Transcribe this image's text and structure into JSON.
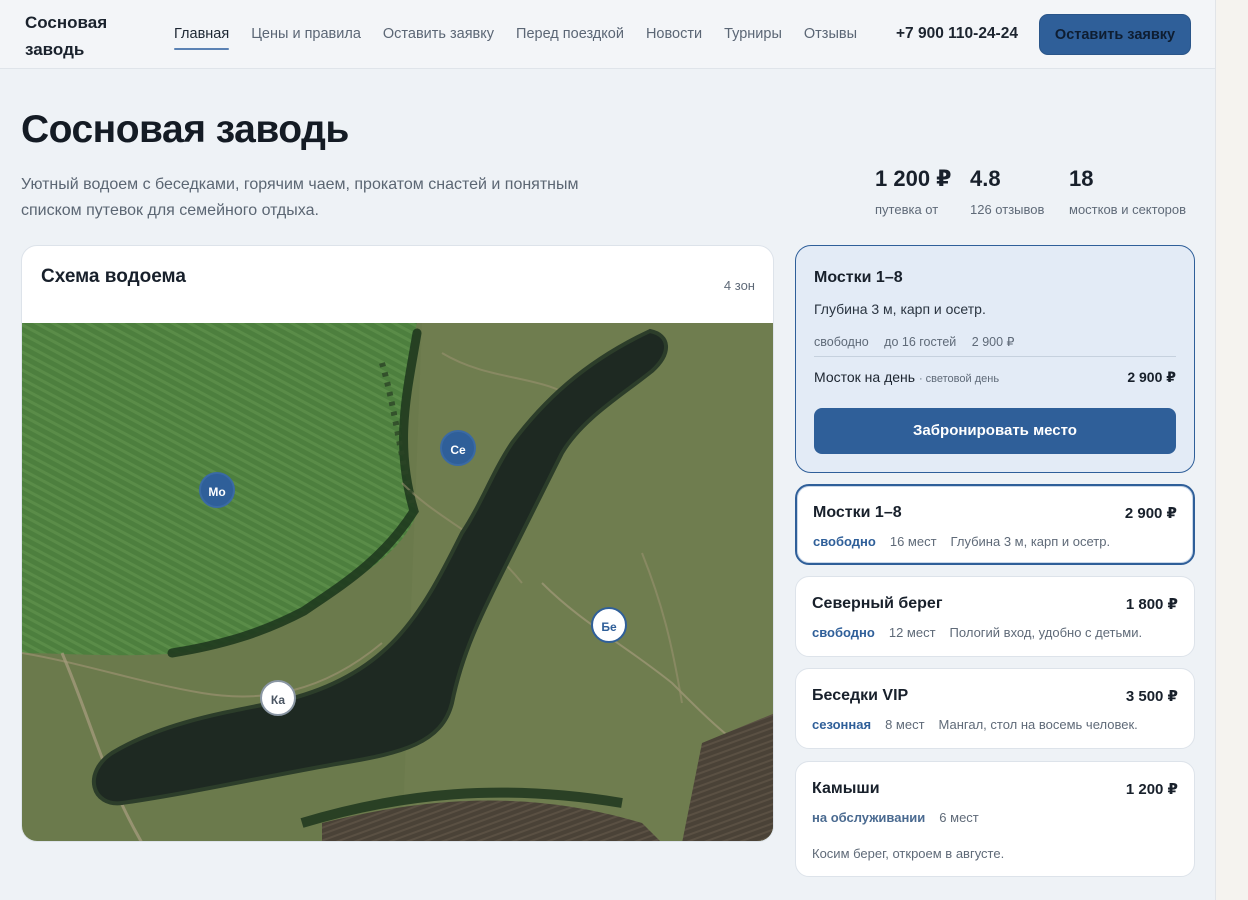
{
  "brand": {
    "line1": "Сосновая",
    "line2": "заводь"
  },
  "nav": [
    {
      "label": "Главная",
      "active": true
    },
    {
      "label": "Цены и правила"
    },
    {
      "label": "Оставить заявку"
    },
    {
      "label": "Перед поездкой"
    },
    {
      "label": "Новости"
    },
    {
      "label": "Турниры"
    },
    {
      "label": "Отзывы"
    }
  ],
  "header": {
    "phone": "+7 900 110-24-24",
    "cta": "Оставить заявку"
  },
  "hero": {
    "title": "Сосновая заводь",
    "subtitle": "Уютный водоем с беседками, горячим чаем, прокатом снастей и понятным списком путевок для семейного отдыха."
  },
  "stats": [
    {
      "value": "1 200 ₽",
      "label": "путевка от"
    },
    {
      "value": "4.8",
      "label": "126 отзывов"
    },
    {
      "value": "18",
      "label": "мостков и секторов"
    }
  ],
  "map": {
    "title": "Схема водоема",
    "zone_count": "4 зон",
    "markers": [
      {
        "label": "Мо",
        "style": "filled"
      },
      {
        "label": "Се",
        "style": "filled"
      },
      {
        "label": "Бе",
        "style": "outline"
      },
      {
        "label": "Ка",
        "style": "plain"
      }
    ]
  },
  "selected": {
    "name": "Мостки 1–8",
    "description": "Глубина 3 м, карп и осетр.",
    "meta": [
      "свободно",
      "до 16 гостей",
      "2 900 ₽"
    ],
    "rate_label": "Мосток на день",
    "rate_note": "· световой день",
    "rate_price": "2 900 ₽",
    "book_button": "Забронировать место"
  },
  "zones": [
    {
      "name": "Мостки 1–8",
      "price": "2 900 ₽",
      "status": "свободно",
      "places": "16 мест",
      "description": "Глубина 3 м, карп и осетр.",
      "active": true
    },
    {
      "name": "Северный берег",
      "price": "1 800 ₽",
      "status": "свободно",
      "places": "12 мест",
      "description": "Пологий вход, удобно с детьми."
    },
    {
      "name": "Беседки VIP",
      "price": "3 500 ₽",
      "status": "сезонная",
      "places": "8 мест",
      "description": "Мангал, стол на восемь человек."
    },
    {
      "name": "Камыши",
      "price": "1 200 ₽",
      "status": "на обслуживании",
      "places": "6 мест",
      "description": "Косим берег, откроем в августе."
    }
  ],
  "colors": {
    "accent": "#2f5f99",
    "page_bg": "#eef2f6",
    "water": "#1f2a24",
    "field": "#4a7a3c"
  }
}
